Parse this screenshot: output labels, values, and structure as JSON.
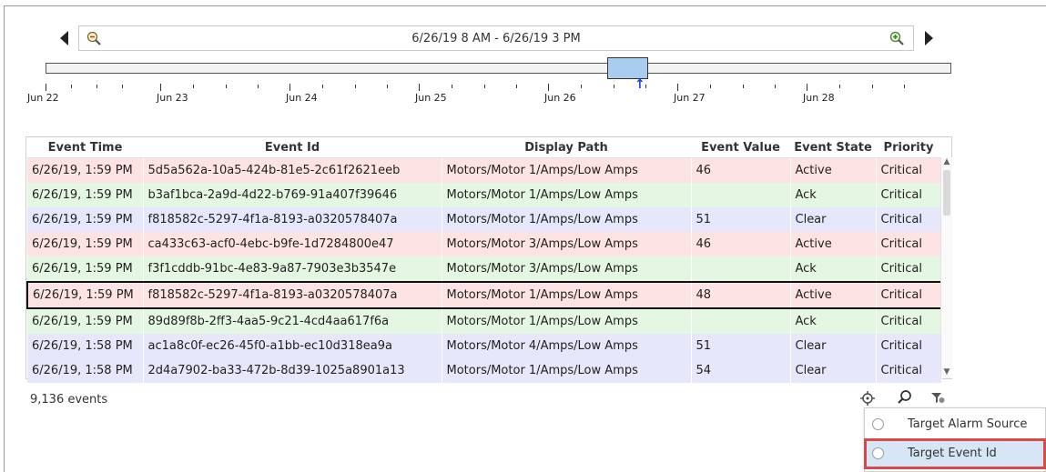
{
  "timeline": {
    "range_text": "6/26/19 8 AM - 6/26/19 3 PM",
    "tick_labels": [
      "Jun 22",
      "Jun 23",
      "Jun 24",
      "Jun 25",
      "Jun 26",
      "Jun 27",
      "Jun 28"
    ],
    "now_marker": "↑",
    "icons": [
      "prev-arrow-icon",
      "zoom-out-icon",
      "zoom-in-icon",
      "next-arrow-icon"
    ]
  },
  "table": {
    "columns": [
      "Event Time",
      "Event Id",
      "Display Path",
      "Event Value",
      "Event State",
      "Priority"
    ],
    "rows": [
      [
        "6/26/19, 1:59 PM",
        "5d5a562a-10a5-424b-81e5-2c61f2621eeb",
        "Motors/Motor 1/Amps/Low Amps",
        "46",
        "Active",
        "Critical"
      ],
      [
        "6/26/19, 1:59 PM",
        "b3af1bca-2a9d-4d22-b769-91a407f39646",
        "Motors/Motor 1/Amps/Low Amps",
        "",
        "Ack",
        "Critical"
      ],
      [
        "6/26/19, 1:59 PM",
        "f818582c-5297-4f1a-8193-a0320578407a",
        "Motors/Motor 1/Amps/Low Amps",
        "51",
        "Clear",
        "Critical"
      ],
      [
        "6/26/19, 1:59 PM",
        "ca433c63-acf0-4ebc-b9fe-1d7284800e47",
        "Motors/Motor 3/Amps/Low Amps",
        "46",
        "Active",
        "Critical"
      ],
      [
        "6/26/19, 1:59 PM",
        "f3f1cddb-91bc-4e83-9a87-7903e3b3547e",
        "Motors/Motor 3/Amps/Low Amps",
        "",
        "Ack",
        "Critical"
      ],
      [
        "6/26/19, 1:59 PM",
        "f818582c-5297-4f1a-8193-a0320578407a",
        "Motors/Motor 1/Amps/Low Amps",
        "48",
        "Active",
        "Critical"
      ],
      [
        "6/26/19, 1:59 PM",
        "89d89f8b-2ff3-4aa5-9c21-4cd4aa617f6a",
        "Motors/Motor 1/Amps/Low Amps",
        "",
        "Ack",
        "Critical"
      ],
      [
        "6/26/19, 1:58 PM",
        "ac1a8c0f-ec26-45f0-a1bb-ec10d318ea9a",
        "Motors/Motor 4/Amps/Low Amps",
        "51",
        "Clear",
        "Critical"
      ],
      [
        "6/26/19, 1:58 PM",
        "2d4a7902-ba33-472b-8d39-1025a8901a13",
        "Motors/Motor 1/Amps/Low Amps",
        "54",
        "Clear",
        "Critical"
      ]
    ],
    "selected_row": 5,
    "colors": {
      "active": "#fde3e3",
      "ack": "#e4f7e3",
      "clear": "#e6e7fa"
    }
  },
  "footer": {
    "event_count": "9,136 events",
    "tools": [
      "target-icon",
      "search-icon",
      "filter-icon"
    ]
  },
  "context_menu": {
    "items": [
      {
        "label": "Target Alarm Source",
        "selected": false
      },
      {
        "label": "Target Event Id",
        "selected": true
      }
    ],
    "highlight_color": "#d64a4a"
  }
}
